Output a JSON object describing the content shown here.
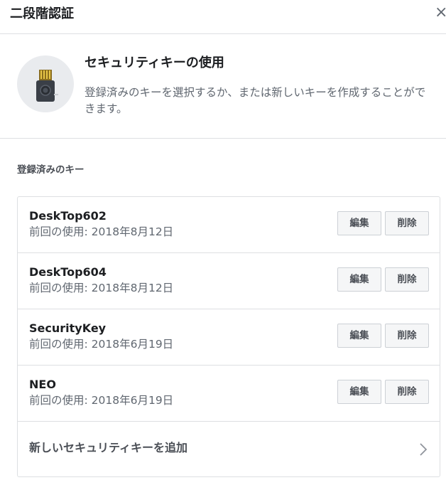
{
  "dialog": {
    "title": "二段階認証",
    "close_symbol": "×"
  },
  "intro": {
    "title": "セキュリティキーの使用",
    "description": "登録済みのキーを選択するか、または新しいキーを作成することができます。"
  },
  "keys_section": {
    "label": "登録済みのキー",
    "items": [
      {
        "name": "DeskTop602",
        "last_used": "前回の使用: 2018年8月12日",
        "edit_label": "編集",
        "delete_label": "削除"
      },
      {
        "name": "DeskTop604",
        "last_used": "前回の使用: 2018年8月12日",
        "edit_label": "編集",
        "delete_label": "削除"
      },
      {
        "name": "SecurityKey",
        "last_used": "前回の使用: 2018年6月19日",
        "edit_label": "編集",
        "delete_label": "削除"
      },
      {
        "name": "NEO",
        "last_used": "前回の使用: 2018年6月19日",
        "edit_label": "編集",
        "delete_label": "削除"
      }
    ],
    "add_label": "新しいセキュリティキーを追加"
  },
  "icons": {
    "close": "close-icon",
    "key": "security-key-icon",
    "chevron": "chevron-right-icon"
  }
}
